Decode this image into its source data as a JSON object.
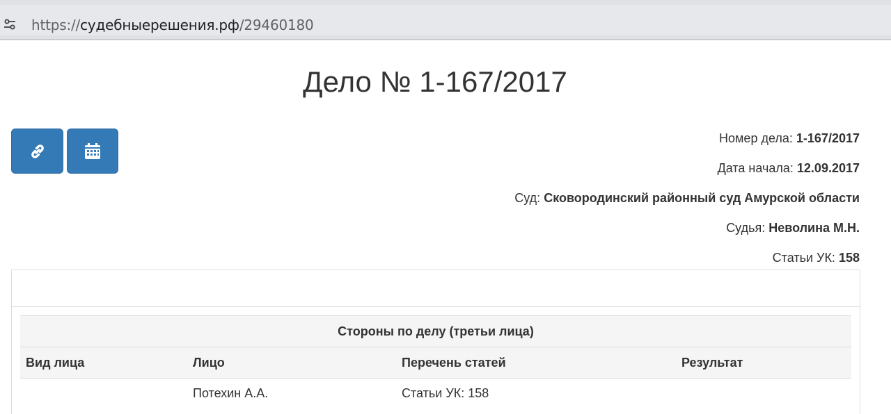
{
  "browser": {
    "url_scheme": "https://",
    "url_host": "судебныерешения.рф",
    "url_path": "/29460180",
    "site_icon": "tune-icon"
  },
  "page": {
    "title": "Дело № 1-167/2017"
  },
  "toolbar": {
    "buttons": [
      {
        "icon": "link-icon"
      },
      {
        "icon": "calendar-icon"
      }
    ],
    "accent_color": "#337ab7"
  },
  "case_info": [
    {
      "label": "Номер дела:",
      "value": "1-167/2017"
    },
    {
      "label": "Дата начала:",
      "value": "12.09.2017"
    },
    {
      "label": "Суд:",
      "value": "Сковородинский районный суд Амурской области"
    },
    {
      "label": "Судья:",
      "value": "Неволина М.Н."
    },
    {
      "label": "Статьи УК:",
      "value": "158"
    }
  ],
  "parties": {
    "caption": "Стороны по делу (третьи лица)",
    "columns": [
      "Вид лица",
      "Лицо",
      "Перечень статей",
      "Результат"
    ],
    "rows": [
      [
        "",
        "Потехин А.А.",
        "Статьи УК: 158",
        ""
      ]
    ]
  }
}
